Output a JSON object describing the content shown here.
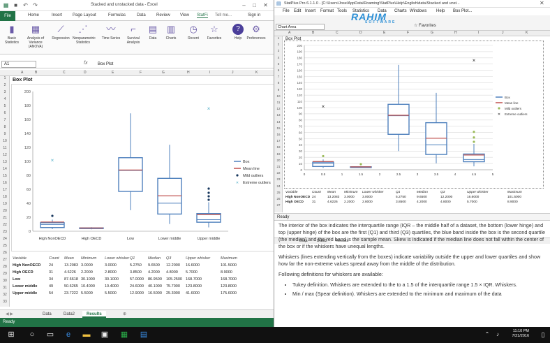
{
  "excel": {
    "title": "Stacked and unstacked data - Excel",
    "ribbon_tabs": [
      "File",
      "Home",
      "Insert",
      "Page Layout",
      "Formulas",
      "Data",
      "Review",
      "View",
      "StatFi",
      "Tell me...",
      "Sign in"
    ],
    "share_label": "Share",
    "ribbon_buttons": [
      {
        "label": "Basic Statistics",
        "icon": "bars-icon"
      },
      {
        "label": "Analysis of Variance (ANOVA)",
        "icon": "grid-icon"
      },
      {
        "label": "Regression",
        "icon": "regression-icon"
      },
      {
        "label": "Nonparametric Statistics",
        "icon": "nonparam-icon"
      },
      {
        "label": "Time Series",
        "icon": "timeseries-icon"
      },
      {
        "label": "Survival Analysis",
        "icon": "survival-icon"
      },
      {
        "label": "Data",
        "icon": "data-icon"
      },
      {
        "label": "Charts",
        "icon": "charts-icon"
      },
      {
        "label": "Recent",
        "icon": "clock-icon"
      },
      {
        "label": "Favorites",
        "icon": "star-icon"
      },
      {
        "label": "Help",
        "icon": "help-icon"
      },
      {
        "label": "Preferences",
        "icon": "gear-icon"
      }
    ],
    "name_box": "A1",
    "formula": "Box Plot",
    "columns": [
      "A",
      "B",
      "C",
      "D",
      "E",
      "F",
      "G",
      "H",
      "I",
      "J",
      "K"
    ],
    "rows": [
      "1",
      "2",
      "3",
      "4",
      "5",
      "6",
      "7",
      "8",
      "9",
      "10",
      "11",
      "12",
      "13",
      "14",
      "15",
      "16",
      "17",
      "18",
      "19",
      "20",
      "21",
      "22",
      "23",
      "24",
      "25",
      "26",
      "27",
      "28",
      "29",
      "30",
      "31",
      "32",
      "33"
    ],
    "sheet_title": "Box Plot",
    "table_headers": [
      "Variable",
      "Count",
      "Mean",
      "Minimum",
      "Lower whisker",
      "Q1",
      "Median",
      "Q3",
      "Upper whisker",
      "Maximum"
    ],
    "table_rows": [
      [
        "High NonOECD",
        "24",
        "13.2083",
        "3.0000",
        "3.0000",
        "5.2750",
        "9.6500",
        "12.2000",
        "16.6000",
        "101.5000"
      ],
      [
        "High OECD",
        "31",
        "4.6226",
        "2.2000",
        "2.8000",
        "3.8500",
        "4.2000",
        "4.8000",
        "5.7000",
        "8.9000"
      ],
      [
        "Low",
        "34",
        "87.6618",
        "30.1000",
        "30.1000",
        "57.0000",
        "86.9500",
        "105.2500",
        "168.7000",
        "168.7000"
      ],
      [
        "Lower middle",
        "49",
        "50.6265",
        "10.4000",
        "10.4000",
        "24.6000",
        "40.1000",
        "75.7000",
        "123.8000",
        "123.8000"
      ],
      [
        "Upper middle",
        "54",
        "23.7222",
        "5.5000",
        "5.5000",
        "12.9000",
        "16.5000",
        "25.3000",
        "41.6000",
        "175.6000"
      ]
    ],
    "sheet_tabs": [
      "Data",
      "Data2",
      "Results"
    ],
    "active_sheet": "Results",
    "status": "Ready"
  },
  "statplus": {
    "title": "StatPlus Pro 6.1.1.0 - [C:\\Users\\Jose\\AppData\\Roaming\\StatPlus\\Help\\English\\data\\Stacked and unst...",
    "menu": [
      "File",
      "Edit",
      "Insert",
      "Format",
      "Tools",
      "Statistics",
      "Data",
      "Charts",
      "Windows",
      "Help",
      "Box Plot..."
    ],
    "name_box": "Chart Area",
    "favorites_label": "Favorites",
    "watermark": "RAHIM",
    "watermark_sub": "SOFTWARE",
    "columns": [
      "A",
      "B",
      "C",
      "D",
      "E",
      "F",
      "G",
      "H",
      "I",
      "J",
      "K"
    ],
    "rows": [
      "1",
      "2",
      "3",
      "4",
      "5",
      "6",
      "7",
      "8",
      "9",
      "10",
      "11",
      "12",
      "13",
      "14",
      "15",
      "16",
      "17",
      "18",
      "19",
      "20",
      "21",
      "22",
      "23",
      "24",
      "25",
      "26",
      "27"
    ],
    "sheet_title": "Box Plot",
    "table_headers": [
      "Variable",
      "Count",
      "Mean",
      "Minimum",
      "Lower whisker",
      "Q1",
      "Median",
      "Q3",
      "Upper whisker",
      "Maximum"
    ],
    "table_rows": [
      [
        "High NonOECD",
        "24",
        "13.2083",
        "3.0000",
        "3.0000",
        "5.2750",
        "9.6500",
        "12.2000",
        "16.6000",
        "101.5000"
      ],
      [
        "High OECD",
        "31",
        "4.6226",
        "2.2000",
        "2.8000",
        "3.8500",
        "4.2000",
        "4.8000",
        "5.7000",
        "8.9000"
      ]
    ],
    "sheet_tabs": [
      "Data",
      "Data2",
      "Results"
    ],
    "status": "Ready",
    "help_p1": "The interior of the box indicates the interquartile range (IQR – the middle half of a dataset, the bottom (lower hinge) and top (upper hinge) of the box are the first (Q1) and third (Q3) quartiles, the blue band inside the box is the second quartile (the median) and the red band is the sample mean. Skew is indicated if the median line does not fall within the center of the box or if the whiskers have unequal lengths.",
    "help_p2": "Whiskers (lines extending vertically from the boxes) indicate variability outside the upper and lower quartiles and show how far the non-extreme values spread away from the middle of the distribution.",
    "help_p3": "Following definitions for whiskers are available:",
    "help_li1": "Tukey definition. Whiskers are extended to the to a 1.5 of the interquartile range 1.5 × IQR. Whiskers.",
    "help_li2": "Min / max (Spear definition). Whiskers are extended to the minimum and maximum of the data"
  },
  "taskbar": {
    "time": "11:10 PM",
    "date": "7/21/2016"
  },
  "chart_data": [
    {
      "type": "box",
      "title": "",
      "categories": [
        "High NonOECD",
        "High OECD",
        "Low",
        "Lower middle",
        "Upper middle"
      ],
      "ylim": [
        0,
        200
      ],
      "yticks": [
        0,
        20,
        40,
        60,
        80,
        100,
        120,
        140,
        160,
        180,
        200
      ],
      "boxes": [
        {
          "min": 3.0,
          "q1": 5.275,
          "median": 9.65,
          "q3": 12.2,
          "max": 16.6,
          "mean": 13.2083
        },
        {
          "min": 2.8,
          "q1": 3.85,
          "median": 4.2,
          "q3": 4.8,
          "max": 5.7,
          "mean": 4.6226
        },
        {
          "min": 30.1,
          "q1": 57.0,
          "median": 86.95,
          "q3": 105.25,
          "max": 168.7,
          "mean": 87.6618
        },
        {
          "min": 10.4,
          "q1": 24.6,
          "median": 40.1,
          "q3": 75.7,
          "max": 123.8,
          "mean": 50.6265
        },
        {
          "min": 5.5,
          "q1": 12.9,
          "median": 16.5,
          "q3": 25.3,
          "max": 41.6,
          "mean": 23.7222
        }
      ],
      "extreme_outliers": [
        {
          "cat": 0,
          "y": 101.5
        },
        {
          "cat": 4,
          "y": 175.6
        }
      ],
      "mild_outliers": [
        {
          "cat": 0,
          "y": 22
        },
        {
          "cat": 4,
          "y": 45
        },
        {
          "cat": 4,
          "y": 50
        },
        {
          "cat": 4,
          "y": 55
        },
        {
          "cat": 4,
          "y": 61
        }
      ],
      "legend": [
        "Box",
        "Mean line",
        "Mild outliers",
        "Extreme outliers"
      ],
      "legend_position": "right",
      "colors": {
        "box": "#4f81bd",
        "mean": "#c0504d",
        "mild": "#17375e",
        "extreme": "#4bacc6"
      }
    },
    {
      "type": "box",
      "title": "",
      "x": [
        0,
        0.5,
        1,
        1.5,
        2,
        2.5,
        3,
        3.5,
        4,
        4.5,
        5
      ],
      "ylim": [
        0,
        200
      ],
      "yticks": [
        0,
        10,
        20,
        30,
        40,
        50,
        60,
        70,
        80,
        90,
        100,
        110,
        120,
        130,
        140,
        150,
        160,
        170,
        180,
        190,
        200
      ],
      "boxes": [
        {
          "x": 0.5,
          "min": 3.0,
          "q1": 5.275,
          "median": 9.65,
          "q3": 12.2,
          "max": 16.6,
          "mean": 13.2083
        },
        {
          "x": 1.5,
          "min": 2.8,
          "q1": 3.85,
          "median": 4.2,
          "q3": 4.8,
          "max": 5.7,
          "mean": 4.6226
        },
        {
          "x": 2.5,
          "min": 30.1,
          "q1": 57.0,
          "median": 86.95,
          "q3": 105.25,
          "max": 168.7,
          "mean": 87.6618
        },
        {
          "x": 3.5,
          "min": 10.4,
          "q1": 24.6,
          "median": 40.1,
          "q3": 75.7,
          "max": 123.8,
          "mean": 50.6265
        },
        {
          "x": 4.5,
          "min": 5.5,
          "q1": 12.9,
          "median": 16.5,
          "q3": 25.3,
          "max": 41.6,
          "mean": 23.7222
        }
      ],
      "extreme_outliers": [
        {
          "x": 0.5,
          "y": 101.5
        },
        {
          "x": 4.5,
          "y": 175.6
        }
      ],
      "mild_outliers": [
        {
          "x": 0.5,
          "y": 22
        },
        {
          "x": 1.5,
          "y": 9
        },
        {
          "x": 4.5,
          "y": 45
        },
        {
          "x": 4.5,
          "y": 52
        },
        {
          "x": 4.5,
          "y": 61
        }
      ],
      "legend": [
        "Box",
        "Mean line",
        "Mild outliers",
        "Extreme outliers"
      ],
      "legend_position": "right",
      "colors": {
        "box": "#4f81bd",
        "mean": "#c0504d",
        "mild": "#9bbb59",
        "extreme": "#222222"
      }
    }
  ]
}
